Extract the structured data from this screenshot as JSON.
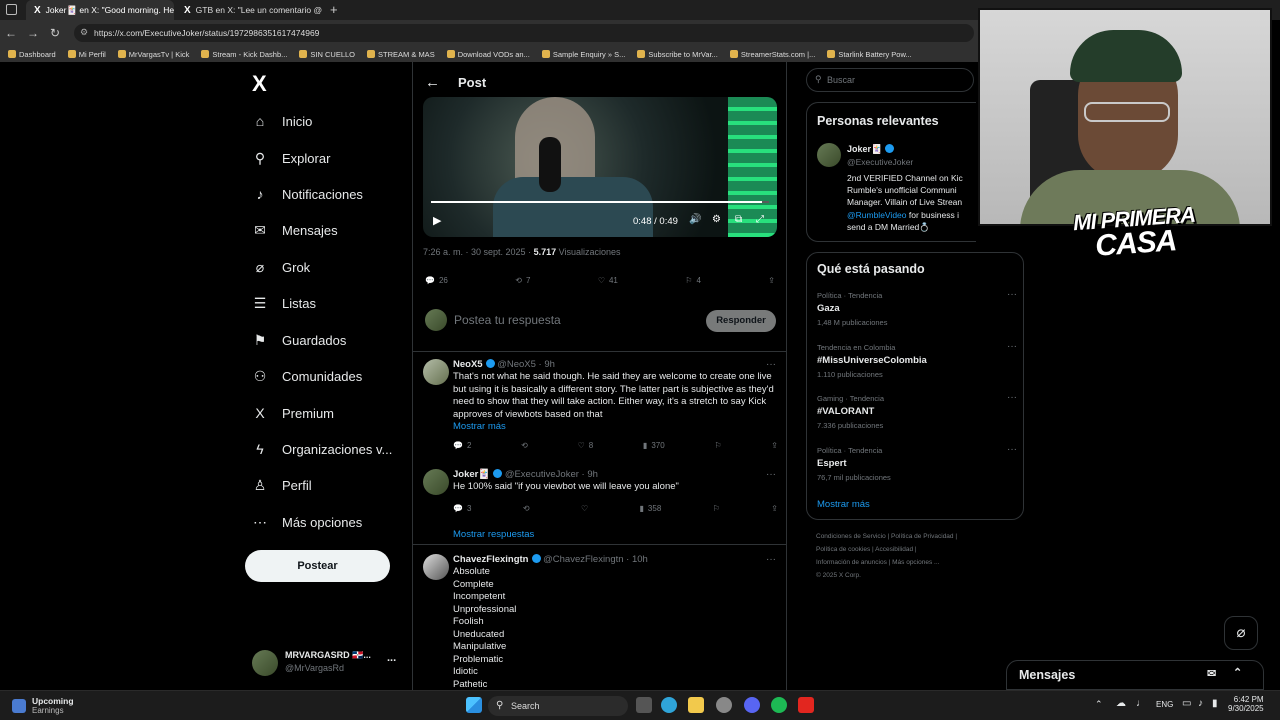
{
  "browser": {
    "tabs": [
      {
        "title": "Joker🃏 en X: \"Good morning. He",
        "active": true
      },
      {
        "title": "GTB en X: \"Lee un comentario @",
        "active": false
      }
    ],
    "new_tab": "+",
    "url": "https://x.com/ExecutiveJoker/status/1972986351617474969",
    "bookmarks": [
      "Dashboard",
      "Mi Perfil",
      "MrVargasTv | Kick",
      "Stream - Kick Dashb...",
      "SIN CUELLO",
      "STREAM & MAS",
      "Download VODs an...",
      "Sample Enquiry » S...",
      "Subscribe to MrVar...",
      "StreamerStats.com |...",
      "Starlink Battery Pow..."
    ]
  },
  "nav": {
    "logo": "X",
    "items": [
      {
        "label": "Inicio",
        "icon": "home-icon",
        "glyph": "⌂"
      },
      {
        "label": "Explorar",
        "icon": "search-icon",
        "glyph": "⚲"
      },
      {
        "label": "Notificaciones",
        "icon": "bell-icon",
        "glyph": "♪"
      },
      {
        "label": "Mensajes",
        "icon": "mail-icon",
        "glyph": "✉"
      },
      {
        "label": "Grok",
        "icon": "grok-icon",
        "glyph": "⌀"
      },
      {
        "label": "Listas",
        "icon": "list-icon",
        "glyph": "☰"
      },
      {
        "label": "Guardados",
        "icon": "bookmark-icon",
        "glyph": "⚑"
      },
      {
        "label": "Comunidades",
        "icon": "people-icon",
        "glyph": "⚇"
      },
      {
        "label": "Premium",
        "icon": "x-premium-icon",
        "glyph": "X"
      },
      {
        "label": "Organizaciones v...",
        "icon": "lightning-icon",
        "glyph": "ϟ"
      },
      {
        "label": "Perfil",
        "icon": "person-icon",
        "glyph": "♙"
      },
      {
        "label": "Más opciones",
        "icon": "more-circle-icon",
        "glyph": "⋯"
      }
    ],
    "post_button": "Postear",
    "account": {
      "name": "MRVARGASRD 🇩🇴...",
      "handle": "@MrVargasRd",
      "more": "..."
    }
  },
  "post": {
    "header": "Post",
    "video": {
      "time": "0:48 / 0:49",
      "progress": 0.98
    },
    "timestamp": "7:26 a. m. · 30 sept. 2025 ·",
    "views_count": "5.717",
    "views_label": "Visualizaciones",
    "stats": {
      "replies": "26",
      "reposts": "7",
      "likes": "41",
      "bookmarks": "4"
    },
    "reply_placeholder": "Postea tu respuesta",
    "reply_button": "Responder"
  },
  "replies": [
    {
      "name": "NeoX5",
      "handle": "@NeoX5 · 9h",
      "text": "That's not what he said though. He said they are welcome to create one live but using it is basically a different story. The latter part is subjective as they'd need to show that they will take action. Either way, it's a stretch to say Kick approves of viewbots based on that",
      "show_more": "Mostrar más",
      "replies": "2",
      "reposts": "",
      "likes": "8",
      "views": "370"
    },
    {
      "name": "Joker🃏",
      "handle": "@ExecutiveJoker · 9h",
      "text": "He 100% said \"if you viewbot we will leave you alone\"",
      "replies": "3",
      "reposts": "",
      "likes": "",
      "views": "358"
    },
    {
      "name": "ChavezFlexingtn",
      "handle": "@ChavezFlexingtn · 10h",
      "lines": [
        "Absolute",
        "Complete",
        "Incompetent",
        "Unprofessional",
        "Foolish",
        "Uneducated",
        "Manipulative",
        "Problematic",
        "Idiotic",
        "Pathetic"
      ]
    }
  ],
  "show_replies": "Mostrar respuestas",
  "sidebar": {
    "search_placeholder": "Buscar",
    "relevant": {
      "title": "Personas relevantes",
      "name": "Joker🃏",
      "handle": "@ExecutiveJoker",
      "bio_lines": [
        "2nd VERIFIED Channel on Kic",
        "Rumble's unofficial Communi",
        "Manager. Villain of Live Strean"
      ],
      "mention": "@RumbleVideo",
      "bio_after_mention": " for business i",
      "bio_last": "send a DM Married💍"
    },
    "trends_title": "Qué está pasando",
    "trends": [
      {
        "context": "Política · Tendencia",
        "title": "Gaza",
        "count": "1,48 M publicaciones"
      },
      {
        "context": "Tendencia en Colombia",
        "title": "#MissUniverseColombia",
        "count": "1.110 publicaciones"
      },
      {
        "context": "Gaming · Tendencia",
        "title": "#VALORANT",
        "count": "7.336 publicaciones"
      },
      {
        "context": "Política · Tendencia",
        "title": "Espert",
        "count": "76,7 mil publicaciones"
      }
    ],
    "show_more": "Mostrar más",
    "footer_lines": [
      "Condiciones de Servicio  |  Política de Privacidad  |",
      "Política de cookies  |  Accesibilidad  |",
      "Información de anuncios  |  Más opciones ...",
      "© 2025 X Corp."
    ]
  },
  "webcam": {
    "overlay_line1": "MI PRIMERA",
    "overlay_line2": "CASA"
  },
  "messages_drawer": "Mensajes",
  "taskbar": {
    "widget_title": "Upcoming",
    "widget_sub": "Earnings",
    "search": "Search",
    "lang": "ENG",
    "time": "6:42 PM",
    "date": "9/30/2025"
  }
}
